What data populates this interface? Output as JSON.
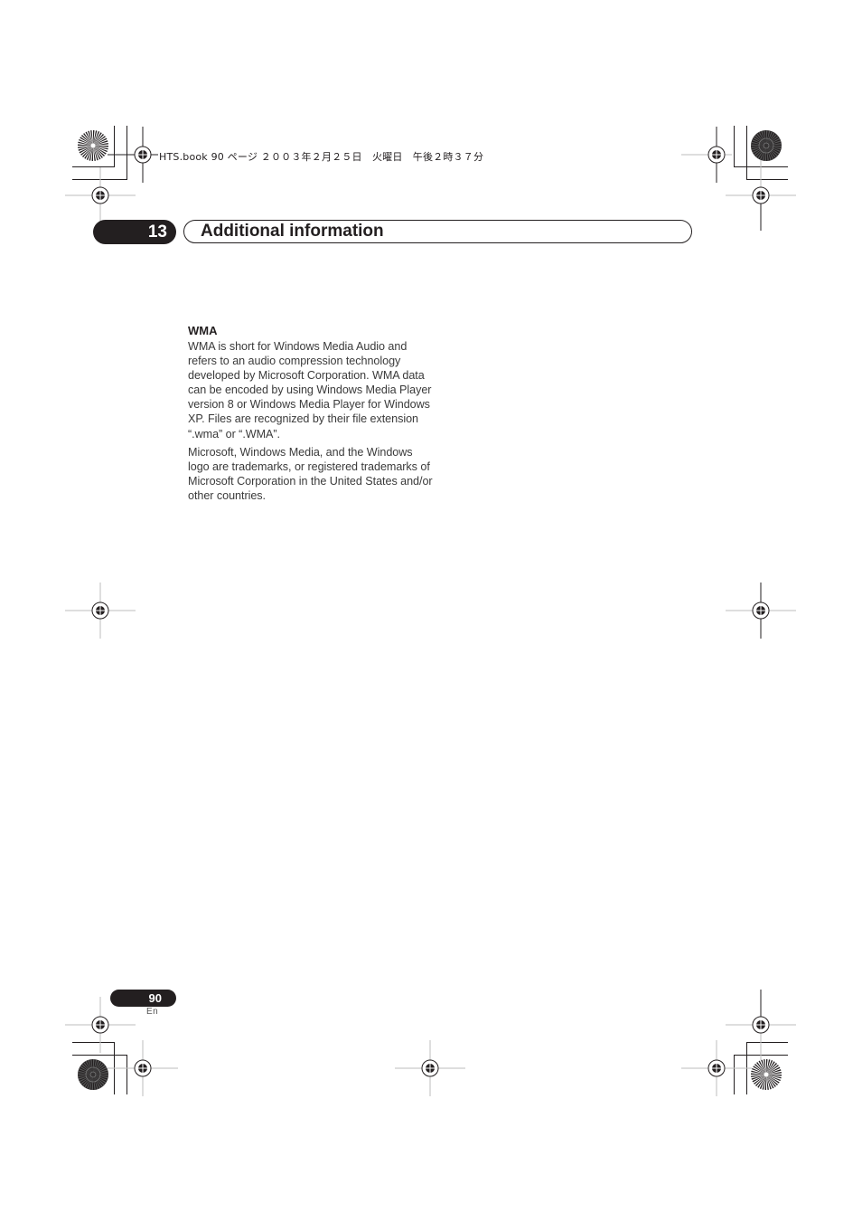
{
  "slug_line": "HTS.book  90 ページ  ２００３年２月２５日　火曜日　午後２時３７分",
  "chapter": {
    "number": "13",
    "title": "Additional information"
  },
  "section": {
    "heading": "WMA",
    "paragraphs": [
      "WMA is short for Windows Media Audio and refers to an audio compression technology developed by Microsoft Corporation. WMA data can be encoded by using Windows Media Player version 8 or Windows Media Player for Windows XP. Files are recognized by their file extension “.wma” or “.WMA”.",
      "Microsoft, Windows Media, and the Windows logo are trademarks, or registered trademarks of Microsoft Corporation in the United States and/or other countries."
    ]
  },
  "footer": {
    "page_number": "90",
    "language": "En"
  },
  "marks": {
    "registration_targets": [
      "top-left-slug",
      "top-left",
      "top-right-slug",
      "top-right",
      "mid-left",
      "mid-right",
      "bottom-left",
      "bottom-left-slug",
      "bottom-center",
      "bottom-right",
      "bottom-right-slug"
    ],
    "star_targets": [
      "top-left",
      "top-right",
      "bottom-left",
      "bottom-right"
    ]
  },
  "colors": {
    "ink": "#231f20",
    "body_text": "#3a3a3a",
    "guide_gray": "#bdbdbd"
  }
}
